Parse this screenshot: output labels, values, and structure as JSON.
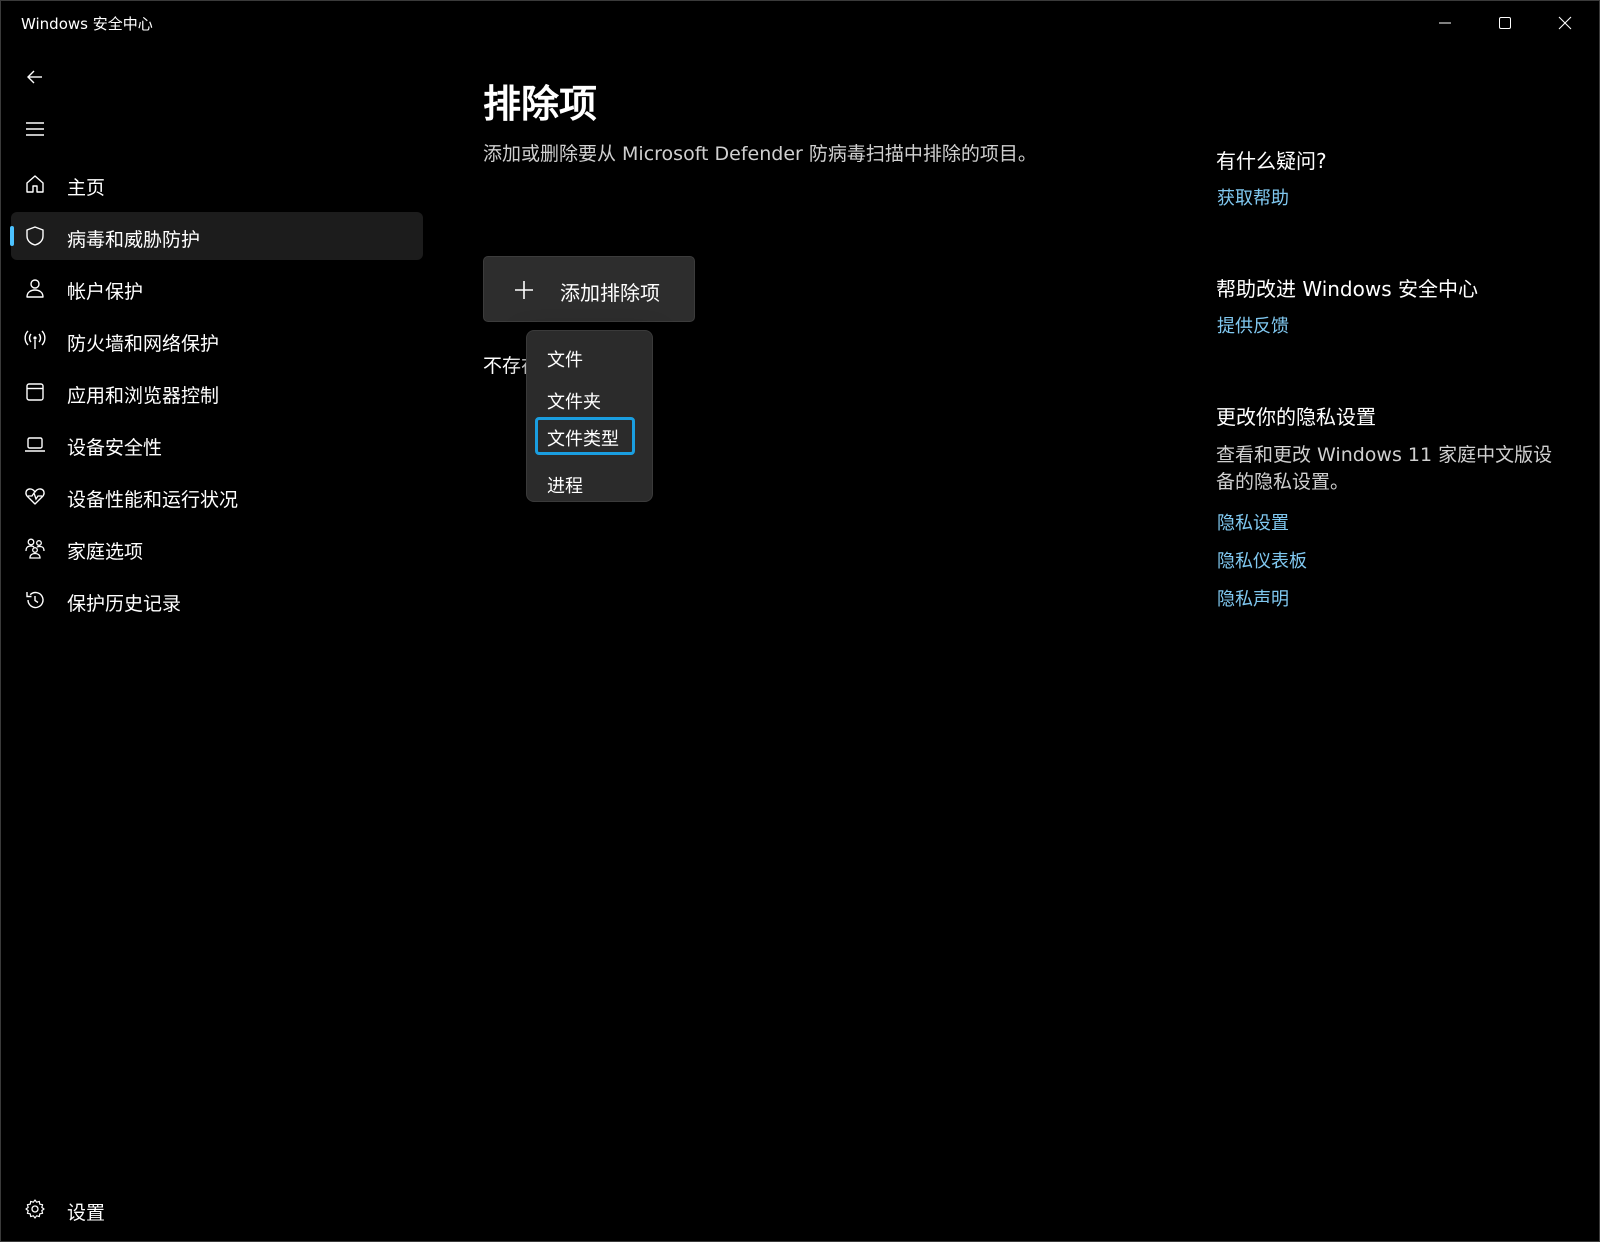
{
  "window": {
    "title": "Windows 安全中心"
  },
  "sidebar": {
    "items": [
      {
        "label": "主页",
        "icon": "home-icon"
      },
      {
        "label": "病毒和威胁防护",
        "icon": "shield-icon",
        "selected": true
      },
      {
        "label": "帐户保护",
        "icon": "person-icon"
      },
      {
        "label": "防火墙和网络保护",
        "icon": "antenna-icon"
      },
      {
        "label": "应用和浏览器控制",
        "icon": "app-window-icon"
      },
      {
        "label": "设备安全性",
        "icon": "laptop-icon"
      },
      {
        "label": "设备性能和运行状况",
        "icon": "heart-pulse-icon"
      },
      {
        "label": "家庭选项",
        "icon": "family-icon"
      },
      {
        "label": "保护历史记录",
        "icon": "history-icon"
      }
    ],
    "settings_label": "设置"
  },
  "main": {
    "title": "排除项",
    "description": "添加或删除要从 Microsoft Defender 防病毒扫描中排除的项目。",
    "add_button_label": "添加排除项",
    "empty_text": "不存在任何排除项。"
  },
  "dropdown": {
    "items": [
      "文件",
      "文件夹",
      "文件类型",
      "进程"
    ],
    "focused_index": 2
  },
  "right_panel": {
    "questions_heading": "有什么疑问?",
    "get_help_link": "获取帮助",
    "improve_heading": "帮助改进 Windows 安全中心",
    "feedback_link": "提供反馈",
    "privacy_heading": "更改你的隐私设置",
    "privacy_text": "查看和更改 Windows 11 家庭中文版设备的隐私设置。",
    "privacy_links": [
      "隐私设置",
      "隐私仪表板",
      "隐私声明"
    ]
  },
  "colors": {
    "accent": "#4cc2ff",
    "link": "#80c8f0",
    "focus_ring": "#1a9ee0",
    "background": "#000000"
  }
}
